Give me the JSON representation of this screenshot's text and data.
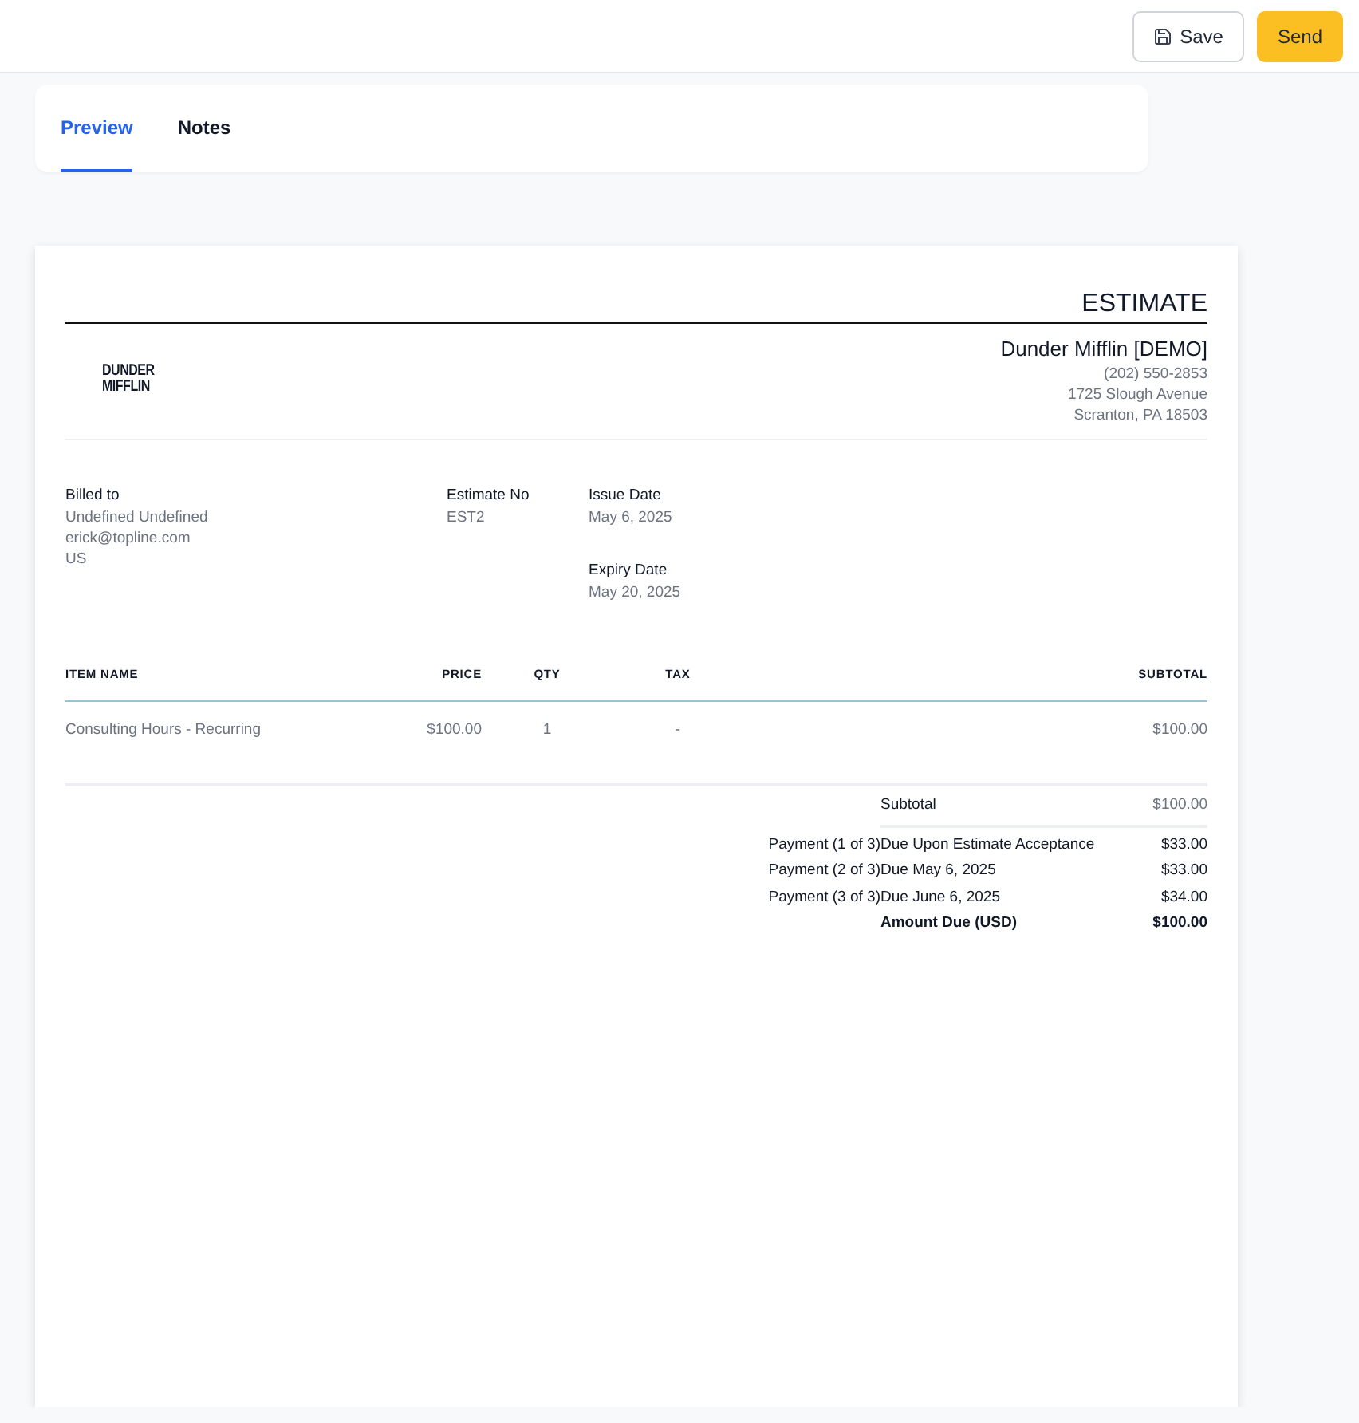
{
  "toolbar": {
    "buttons": [
      {
        "label": "Save",
        "kind": "outline"
      },
      {
        "label": "Send",
        "kind": "primary"
      }
    ]
  },
  "tabs": [
    {
      "label": "Preview",
      "selected": true
    },
    {
      "label": "Notes",
      "selected": false
    }
  ],
  "document": {
    "title": "ESTIMATE",
    "logo": [
      "DUNDER",
      "MIFFLIN"
    ],
    "company": {
      "name": "Dunder Mifflin [DEMO]",
      "lines": [
        "(202) 550-2853",
        "1725 Slough Avenue",
        "Scranton, PA 18503"
      ]
    },
    "billed_to": {
      "label": "Billed to",
      "lines": [
        "Undefined Undefined",
        "erick@topline.com",
        "US"
      ]
    },
    "estimate_no": {
      "label": "Estimate No",
      "value": "EST2"
    },
    "issue_date": {
      "label": "Issue Date",
      "value": "May 6, 2025"
    },
    "expiry_date": {
      "label": "Expiry Date",
      "value": "May 20, 2025"
    },
    "table": {
      "columns": [
        "ITEM NAME",
        "PRICE",
        "QTY",
        "TAX",
        "SUBTOTAL"
      ],
      "rows": [
        [
          "Consulting Hours - Recurring",
          "$100.00",
          "1",
          "-",
          "$100.00"
        ]
      ]
    },
    "subtotal": {
      "label": "Subtotal",
      "value": "$100.00"
    },
    "payments": [
      {
        "label": "Payment (1 of 3)",
        "due": "Due Upon Estimate Acceptance",
        "amount": "$33.00"
      },
      {
        "label": "Payment (2 of 3)",
        "due": "Due May 6, 2025",
        "amount": "$33.00"
      },
      {
        "label": "Payment (3 of 3)",
        "due": "Due June 6, 2025",
        "amount": "$34.00"
      }
    ],
    "amount_due": {
      "label": "Amount Due (USD)",
      "value": "$100.00"
    }
  }
}
